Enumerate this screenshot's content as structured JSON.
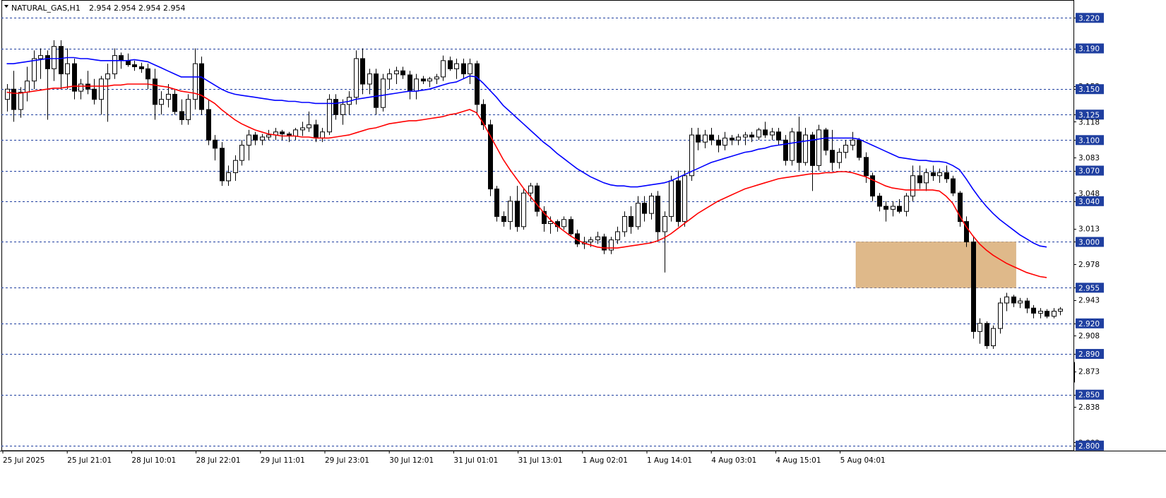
{
  "chart_data": {
    "type": "candlestick",
    "title": "NATURAL_GAS,H1",
    "ohlc_readout": "2.954 2.954 2.954 2.954",
    "ylim": [
      2.795,
      3.232
    ],
    "y_ticks": [
      "3.220",
      "3.190",
      "3.153",
      "3.150",
      "3.125",
      "3.118",
      "3.100",
      "3.083",
      "3.070",
      "3.048",
      "3.040",
      "3.013",
      "3.000",
      "2.978",
      "2.955",
      "2.943",
      "2.920",
      "2.908",
      "2.890",
      "2.873",
      "2.850",
      "2.838",
      "2.803",
      "2.800"
    ],
    "levels": [
      3.22,
      3.19,
      3.15,
      3.125,
      3.1,
      3.07,
      3.04,
      3.0,
      2.955,
      2.92,
      2.89,
      2.85,
      2.8
    ],
    "x_labels": [
      "25 Jul 2025",
      "25 Jul 21:01",
      "28 Jul 10:01",
      "28 Jul 22:01",
      "29 Jul 11:01",
      "29 Jul 23:01",
      "30 Jul 12:01",
      "31 Jul 01:01",
      "31 Jul 13:01",
      "1 Aug 02:01",
      "1 Aug 14:01",
      "4 Aug 03:01",
      "4 Aug 15:01",
      "5 Aug 04:01"
    ],
    "zone": {
      "from_bar": 127,
      "to_bar": 150,
      "low": 2.955,
      "high": 3.0
    },
    "candles": [
      [
        3.14,
        3.155,
        3.128,
        3.15
      ],
      [
        3.15,
        3.168,
        3.118,
        3.13
      ],
      [
        3.13,
        3.152,
        3.122,
        3.147
      ],
      [
        3.147,
        3.172,
        3.138,
        3.158
      ],
      [
        3.158,
        3.188,
        3.15,
        3.18
      ],
      [
        3.18,
        3.19,
        3.16,
        3.183
      ],
      [
        3.183,
        3.188,
        3.12,
        3.17
      ],
      [
        3.17,
        3.198,
        3.158,
        3.192
      ],
      [
        3.192,
        3.198,
        3.15,
        3.165
      ],
      [
        3.165,
        3.19,
        3.15,
        3.175
      ],
      [
        3.175,
        3.18,
        3.14,
        3.148
      ],
      [
        3.148,
        3.16,
        3.14,
        3.155
      ],
      [
        3.155,
        3.168,
        3.145,
        3.15
      ],
      [
        3.15,
        3.16,
        3.135,
        3.14
      ],
      [
        3.14,
        3.163,
        3.125,
        3.16
      ],
      [
        3.16,
        3.175,
        3.118,
        3.165
      ],
      [
        3.165,
        3.19,
        3.16,
        3.183
      ],
      [
        3.183,
        3.186,
        3.17,
        3.178
      ],
      [
        3.178,
        3.185,
        3.172,
        3.174
      ],
      [
        3.174,
        3.178,
        3.168,
        3.172
      ],
      [
        3.172,
        3.176,
        3.166,
        3.17
      ],
      [
        3.17,
        3.175,
        3.15,
        3.16
      ],
      [
        3.16,
        3.17,
        3.12,
        3.135
      ],
      [
        3.135,
        3.148,
        3.125,
        3.14
      ],
      [
        3.14,
        3.155,
        3.132,
        3.145
      ],
      [
        3.145,
        3.15,
        3.125,
        3.128
      ],
      [
        3.128,
        3.14,
        3.115,
        3.12
      ],
      [
        3.12,
        3.145,
        3.115,
        3.14
      ],
      [
        3.14,
        3.19,
        3.13,
        3.175
      ],
      [
        3.175,
        3.182,
        3.125,
        3.13
      ],
      [
        3.13,
        3.14,
        3.095,
        3.1
      ],
      [
        3.1,
        3.105,
        3.08,
        3.092
      ],
      [
        3.092,
        3.098,
        3.055,
        3.06
      ],
      [
        3.06,
        3.075,
        3.055,
        3.068
      ],
      [
        3.068,
        3.085,
        3.06,
        3.08
      ],
      [
        3.08,
        3.1,
        3.075,
        3.095
      ],
      [
        3.095,
        3.11,
        3.08,
        3.105
      ],
      [
        3.105,
        3.108,
        3.095,
        3.1
      ],
      [
        3.1,
        3.106,
        3.095,
        3.103
      ],
      [
        3.103,
        3.11,
        3.1,
        3.105
      ],
      [
        3.105,
        3.112,
        3.1,
        3.108
      ],
      [
        3.108,
        3.11,
        3.1,
        3.106
      ],
      [
        3.106,
        3.108,
        3.098,
        3.104
      ],
      [
        3.104,
        3.112,
        3.1,
        3.11
      ],
      [
        3.11,
        3.118,
        3.104,
        3.112
      ],
      [
        3.112,
        3.128,
        3.108,
        3.115
      ],
      [
        3.115,
        3.12,
        3.098,
        3.102
      ],
      [
        3.102,
        3.112,
        3.098,
        3.108
      ],
      [
        3.108,
        3.145,
        3.105,
        3.14
      ],
      [
        3.14,
        3.145,
        3.12,
        3.125
      ],
      [
        3.125,
        3.14,
        3.115,
        3.135
      ],
      [
        3.135,
        3.148,
        3.125,
        3.142
      ],
      [
        3.142,
        3.188,
        3.135,
        3.18
      ],
      [
        3.18,
        3.19,
        3.145,
        3.155
      ],
      [
        3.155,
        3.17,
        3.145,
        3.165
      ],
      [
        3.165,
        3.17,
        3.125,
        3.132
      ],
      [
        3.132,
        3.165,
        3.128,
        3.16
      ],
      [
        3.16,
        3.17,
        3.15,
        3.165
      ],
      [
        3.165,
        3.172,
        3.155,
        3.168
      ],
      [
        3.168,
        3.172,
        3.16,
        3.164
      ],
      [
        3.164,
        3.168,
        3.14,
        3.148
      ],
      [
        3.148,
        3.165,
        3.14,
        3.16
      ],
      [
        3.16,
        3.163,
        3.155,
        3.158
      ],
      [
        3.158,
        3.162,
        3.152,
        3.16
      ],
      [
        3.16,
        3.165,
        3.155,
        3.162
      ],
      [
        3.162,
        3.183,
        3.158,
        3.178
      ],
      [
        3.178,
        3.182,
        3.168,
        3.17
      ],
      [
        3.17,
        3.18,
        3.16,
        3.175
      ],
      [
        3.175,
        3.18,
        3.16,
        3.165
      ],
      [
        3.165,
        3.18,
        3.155,
        3.175
      ],
      [
        3.175,
        3.178,
        3.125,
        3.135
      ],
      [
        3.135,
        3.14,
        3.11,
        3.115
      ],
      [
        3.115,
        3.12,
        3.045,
        3.052
      ],
      [
        3.052,
        3.055,
        3.02,
        3.025
      ],
      [
        3.025,
        3.03,
        3.015,
        3.02
      ],
      [
        3.02,
        3.045,
        3.012,
        3.04
      ],
      [
        3.04,
        3.055,
        3.01,
        3.015
      ],
      [
        3.015,
        3.052,
        3.012,
        3.048
      ],
      [
        3.048,
        3.058,
        3.04,
        3.055
      ],
      [
        3.055,
        3.058,
        3.025,
        3.03
      ],
      [
        3.03,
        3.035,
        3.01,
        3.018
      ],
      [
        3.018,
        3.025,
        3.008,
        3.02
      ],
      [
        3.02,
        3.022,
        3.01,
        3.015
      ],
      [
        3.015,
        3.025,
        3.012,
        3.022
      ],
      [
        3.022,
        3.025,
        3.005,
        3.008
      ],
      [
        3.008,
        3.012,
        2.995,
        2.998
      ],
      [
        2.998,
        3.005,
        2.993,
        3.0
      ],
      [
        3.0,
        3.005,
        2.995,
        3.002
      ],
      [
        3.002,
        3.01,
        2.998,
        3.005
      ],
      [
        3.005,
        3.008,
        2.988,
        2.992
      ],
      [
        2.992,
        3.005,
        2.988,
        3.002
      ],
      [
        3.002,
        3.015,
        2.998,
        3.01
      ],
      [
        3.01,
        3.03,
        3.005,
        3.025
      ],
      [
        3.025,
        3.035,
        3.008,
        3.015
      ],
      [
        3.015,
        3.045,
        3.012,
        3.038
      ],
      [
        3.038,
        3.045,
        3.02,
        3.028
      ],
      [
        3.028,
        3.048,
        3.022,
        3.045
      ],
      [
        3.045,
        3.05,
        3.0,
        3.01
      ],
      [
        3.01,
        3.03,
        2.97,
        3.025
      ],
      [
        3.025,
        3.065,
        3.02,
        3.06
      ],
      [
        3.06,
        3.07,
        3.015,
        3.02
      ],
      [
        3.02,
        3.07,
        3.015,
        3.065
      ],
      [
        3.065,
        3.112,
        3.06,
        3.105
      ],
      [
        3.105,
        3.112,
        3.09,
        3.098
      ],
      [
        3.098,
        3.11,
        3.092,
        3.105
      ],
      [
        3.105,
        3.112,
        3.095,
        3.1
      ],
      [
        3.1,
        3.105,
        3.088,
        3.095
      ],
      [
        3.095,
        3.108,
        3.09,
        3.102
      ],
      [
        3.102,
        3.105,
        3.095,
        3.1
      ],
      [
        3.1,
        3.106,
        3.095,
        3.103
      ],
      [
        3.103,
        3.108,
        3.095,
        3.105
      ],
      [
        3.105,
        3.108,
        3.098,
        3.103
      ],
      [
        3.103,
        3.112,
        3.1,
        3.11
      ],
      [
        3.11,
        3.118,
        3.102,
        3.105
      ],
      [
        3.105,
        3.112,
        3.1,
        3.108
      ],
      [
        3.108,
        3.112,
        3.095,
        3.1
      ],
      [
        3.1,
        3.105,
        3.075,
        3.08
      ],
      [
        3.08,
        3.112,
        3.075,
        3.108
      ],
      [
        3.108,
        3.123,
        3.07,
        3.078
      ],
      [
        3.078,
        3.112,
        3.075,
        3.105
      ],
      [
        3.105,
        3.108,
        3.05,
        3.075
      ],
      [
        3.075,
        3.115,
        3.07,
        3.11
      ],
      [
        3.11,
        3.112,
        3.085,
        3.09
      ],
      [
        3.09,
        3.11,
        3.07,
        3.078
      ],
      [
        3.078,
        3.092,
        3.072,
        3.088
      ],
      [
        3.088,
        3.1,
        3.082,
        3.095
      ],
      [
        3.095,
        3.108,
        3.09,
        3.1
      ],
      [
        3.1,
        3.102,
        3.08,
        3.083
      ],
      [
        3.083,
        3.088,
        3.058,
        3.065
      ],
      [
        3.065,
        3.068,
        3.04,
        3.045
      ],
      [
        3.045,
        3.048,
        3.03,
        3.035
      ],
      [
        3.035,
        3.04,
        3.02,
        3.032
      ],
      [
        3.032,
        3.04,
        3.025,
        3.035
      ],
      [
        3.035,
        3.042,
        3.028,
        3.03
      ],
      [
        3.03,
        3.048,
        3.025,
        3.045
      ],
      [
        3.045,
        3.075,
        3.04,
        3.065
      ],
      [
        3.065,
        3.075,
        3.052,
        3.058
      ],
      [
        3.058,
        3.072,
        3.05,
        3.068
      ],
      [
        3.068,
        3.075,
        3.06,
        3.065
      ],
      [
        3.065,
        3.072,
        3.058,
        3.068
      ],
      [
        3.068,
        3.075,
        3.058,
        3.062
      ],
      [
        3.062,
        3.065,
        3.045,
        3.048
      ],
      [
        3.048,
        3.05,
        3.015,
        3.02
      ],
      [
        3.02,
        3.025,
        2.995,
        3.0
      ],
      [
        3.0,
        3.005,
        2.905,
        2.912
      ],
      [
        2.912,
        2.925,
        2.9,
        2.92
      ],
      [
        2.92,
        2.922,
        2.895,
        2.898
      ],
      [
        2.898,
        2.918,
        2.895,
        2.915
      ],
      [
        2.915,
        2.945,
        2.91,
        2.94
      ],
      [
        2.94,
        2.95,
        2.932,
        2.946
      ],
      [
        2.946,
        2.948,
        2.936,
        2.94
      ],
      [
        2.94,
        2.945,
        2.935,
        2.942
      ],
      [
        2.942,
        2.945,
        2.93,
        2.935
      ],
      [
        2.935,
        2.938,
        2.925,
        2.93
      ],
      [
        2.93,
        2.935,
        2.925,
        2.932
      ],
      [
        2.932,
        2.934,
        2.925,
        2.927
      ],
      [
        2.927,
        2.935,
        2.925,
        2.932
      ],
      [
        2.932,
        2.936,
        2.928,
        2.934
      ]
    ],
    "ma_blue": [
      3.175,
      3.175,
      3.176,
      3.177,
      3.178,
      3.179,
      3.18,
      3.18,
      3.18,
      3.181,
      3.181,
      3.18,
      3.18,
      3.179,
      3.178,
      3.178,
      3.178,
      3.178,
      3.178,
      3.179,
      3.178,
      3.177,
      3.174,
      3.171,
      3.168,
      3.165,
      3.162,
      3.162,
      3.162,
      3.162,
      3.158,
      3.154,
      3.15,
      3.147,
      3.145,
      3.144,
      3.143,
      3.142,
      3.141,
      3.14,
      3.139,
      3.139,
      3.138,
      3.138,
      3.137,
      3.137,
      3.136,
      3.136,
      3.136,
      3.136,
      3.137,
      3.138,
      3.14,
      3.141,
      3.142,
      3.143,
      3.144,
      3.145,
      3.146,
      3.147,
      3.148,
      3.148,
      3.149,
      3.15,
      3.152,
      3.154,
      3.156,
      3.157,
      3.16,
      3.163,
      3.162,
      3.156,
      3.149,
      3.142,
      3.134,
      3.128,
      3.122,
      3.116,
      3.11,
      3.104,
      3.098,
      3.093,
      3.087,
      3.082,
      3.077,
      3.072,
      3.068,
      3.064,
      3.061,
      3.058,
      3.056,
      3.055,
      3.055,
      3.054,
      3.054,
      3.055,
      3.056,
      3.057,
      3.058,
      3.06,
      3.063,
      3.066,
      3.069,
      3.072,
      3.075,
      3.078,
      3.08,
      3.082,
      3.084,
      3.086,
      3.088,
      3.089,
      3.091,
      3.092,
      3.094,
      3.095,
      3.096,
      3.097,
      3.098,
      3.099,
      3.1,
      3.101,
      3.102,
      3.102,
      3.102,
      3.102,
      3.102,
      3.101,
      3.098,
      3.095,
      3.092,
      3.089,
      3.086,
      3.083,
      3.082,
      3.081,
      3.08,
      3.08,
      3.079,
      3.079,
      3.078,
      3.075,
      3.071,
      3.062,
      3.052,
      3.043,
      3.035,
      3.028,
      3.022,
      3.017,
      3.012,
      3.007,
      3.003,
      2.999,
      2.996,
      2.995
    ],
    "ma_red": [
      3.147,
      3.146,
      3.146,
      3.147,
      3.148,
      3.149,
      3.15,
      3.151,
      3.151,
      3.152,
      3.153,
      3.153,
      3.153,
      3.153,
      3.153,
      3.153,
      3.154,
      3.154,
      3.155,
      3.155,
      3.155,
      3.155,
      3.154,
      3.153,
      3.152,
      3.15,
      3.148,
      3.147,
      3.146,
      3.144,
      3.14,
      3.136,
      3.13,
      3.125,
      3.12,
      3.116,
      3.113,
      3.11,
      3.108,
      3.106,
      3.105,
      3.104,
      3.104,
      3.104,
      3.103,
      3.103,
      3.102,
      3.102,
      3.102,
      3.103,
      3.104,
      3.105,
      3.107,
      3.109,
      3.111,
      3.112,
      3.114,
      3.116,
      3.117,
      3.118,
      3.119,
      3.119,
      3.12,
      3.121,
      3.122,
      3.123,
      3.125,
      3.126,
      3.128,
      3.13,
      3.127,
      3.117,
      3.105,
      3.093,
      3.081,
      3.071,
      3.062,
      3.053,
      3.045,
      3.037,
      3.029,
      3.022,
      3.016,
      3.011,
      3.006,
      3.002,
      2.999,
      2.997,
      2.995,
      2.994,
      2.994,
      2.994,
      2.995,
      2.996,
      2.997,
      2.998,
      2.999,
      3.001,
      3.004,
      3.008,
      3.013,
      3.018,
      3.023,
      3.028,
      3.032,
      3.036,
      3.04,
      3.043,
      3.046,
      3.049,
      3.052,
      3.054,
      3.056,
      3.058,
      3.06,
      3.062,
      3.063,
      3.064,
      3.065,
      3.066,
      3.067,
      3.067,
      3.068,
      3.068,
      3.069,
      3.069,
      3.068,
      3.066,
      3.064,
      3.061,
      3.058,
      3.055,
      3.053,
      3.052,
      3.051,
      3.051,
      3.051,
      3.051,
      3.051,
      3.05,
      3.045,
      3.038,
      3.026,
      3.015,
      3.006,
      2.998,
      2.992,
      2.987,
      2.983,
      2.979,
      2.976,
      2.973,
      2.97,
      2.968,
      2.966,
      2.965
    ]
  }
}
